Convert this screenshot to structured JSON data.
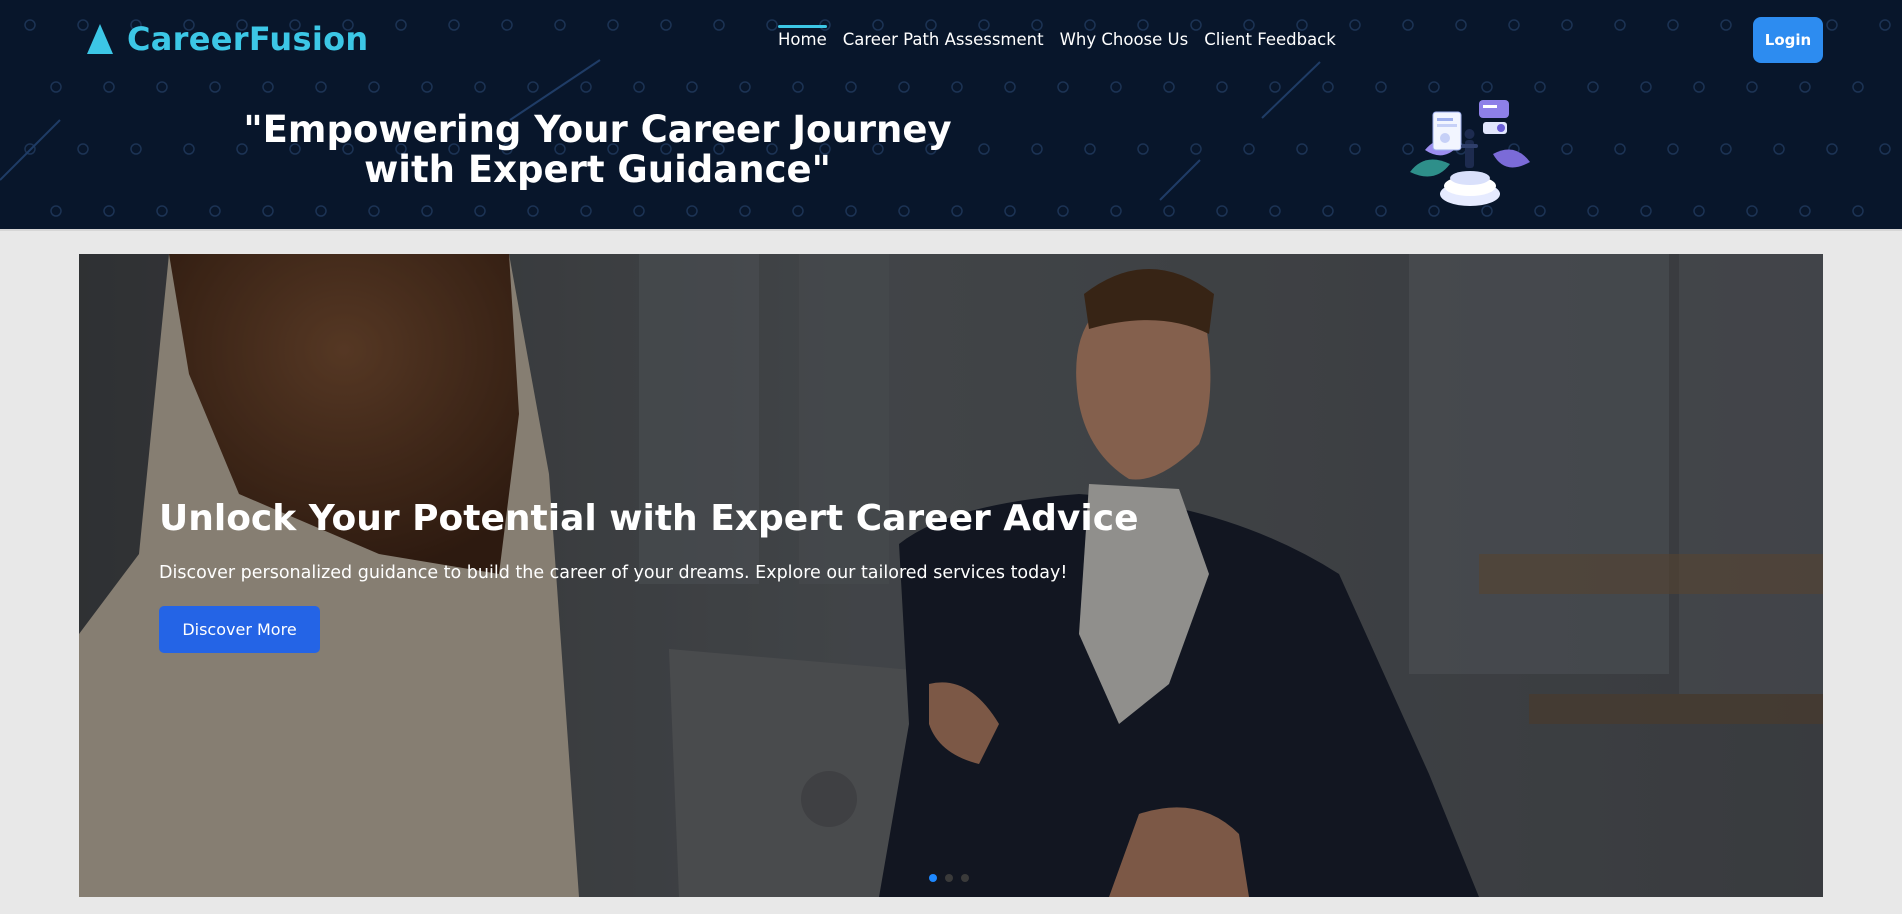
{
  "brand": {
    "name": "CareerFusion",
    "color": "#3cc7e6"
  },
  "nav": {
    "items": [
      {
        "label": "Home",
        "active": true
      },
      {
        "label": "Career Path Assessment",
        "active": false
      },
      {
        "label": "Why Choose Us",
        "active": false
      },
      {
        "label": "Client Feedback",
        "active": false
      }
    ],
    "login_label": "Login"
  },
  "header": {
    "tagline": "\"Empowering Your Career Journey with Expert Guidance\"",
    "background": "#08162b",
    "illustration_icon": "career-platform-illustration-icon"
  },
  "hero": {
    "title": "Unlock Your Potential with Expert Career Advice",
    "subtitle": "Discover personalized guidance to build the career of your dreams. Explore our tailored services today!",
    "cta_label": "Discover More",
    "cta_color": "#2464e6",
    "slide_count": 3,
    "active_slide": 1
  }
}
